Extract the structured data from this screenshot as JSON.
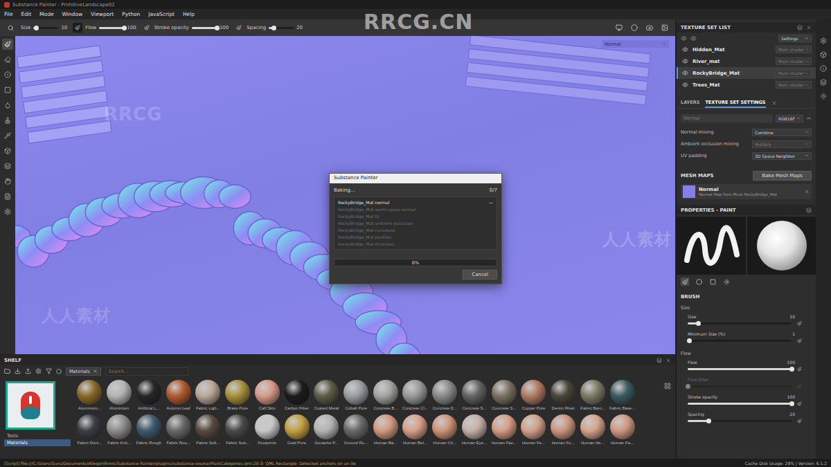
{
  "window": {
    "title": "Substance Painter - PrimitiveLandscape02"
  },
  "menu": [
    "File",
    "Edit",
    "Mode",
    "Window",
    "Viewport",
    "Python",
    "JavaScript",
    "Help"
  ],
  "watermarks": [
    {
      "text": "RRCG.CN"
    },
    {
      "text": "RRCG"
    },
    {
      "text": "人人素材"
    },
    {
      "text": "人人素材"
    }
  ],
  "toolbar": {
    "params": [
      {
        "label": "Size",
        "value": "10",
        "level": 0.1
      },
      {
        "label": "Flow",
        "value": "100",
        "level": 1
      },
      {
        "label": "Stroke opacity",
        "value": "100",
        "level": 1
      },
      {
        "label": "Spacing",
        "value": "20",
        "level": 0.2
      }
    ]
  },
  "tools": [
    {
      "kind": "paint",
      "selected": true
    },
    {
      "kind": "eraser",
      "selected": false
    },
    {
      "kind": "projection",
      "selected": false
    },
    {
      "kind": "polyfill",
      "selected": false
    },
    {
      "kind": "smudge",
      "selected": false
    },
    {
      "kind": "clone",
      "selected": false
    },
    {
      "kind": "picker",
      "selected": false
    },
    {
      "kind": "geometry",
      "selected": false
    },
    {
      "kind": "layers",
      "selected": false
    },
    {
      "kind": "hand",
      "selected": false
    },
    {
      "kind": "script",
      "selected": false
    },
    {
      "kind": "settings",
      "selected": false
    }
  ],
  "viewport": {
    "channel": "Normal"
  },
  "dialog": {
    "title": "Substance Painter",
    "status": "Baking...",
    "count": "0/7",
    "current": {
      "name": "RockyBridge_Mat normal",
      "mark": "—"
    },
    "log": [
      "RockyBridge_Mat world space normal",
      "RockyBridge_Mat ID",
      "RockyBridge_Mat ambient occlusion",
      "RockyBridge_Mat curvature",
      "RockyBridge_Mat position",
      "RockyBridge_Mat thickness"
    ],
    "progress": {
      "level": 0,
      "text": "0%"
    },
    "button": "Cancel"
  },
  "texture_set_list": {
    "title": "TEXTURE SET LIST",
    "settings": "Settings",
    "items": [
      {
        "name": "Hidden_Mat",
        "shader": "Main shader",
        "visible": true,
        "selected": false
      },
      {
        "name": "River_mat",
        "shader": "Main shader",
        "visible": true,
        "selected": false
      },
      {
        "name": "RockyBridge_Mat",
        "shader": "Main shader",
        "visible": true,
        "selected": true
      },
      {
        "name": "Trees_Mat",
        "shader": "Main shader",
        "visible": true,
        "selected": false
      }
    ]
  },
  "tabs": [
    {
      "label": "LAYERS",
      "selected": false
    },
    {
      "label": "TEXTURE SET SETTINGS",
      "selected": true
    }
  ],
  "texture_set_settings": {
    "channel": "Normal",
    "format": "RGB16F",
    "fields": [
      {
        "label": "Normal mixing",
        "value": "Combine",
        "disabled": false
      },
      {
        "label": "Ambient occlusion mixing",
        "value": "Multiply",
        "disabled": true
      },
      {
        "label": "UV padding",
        "value": "3D Space Neighbor",
        "disabled": false
      }
    ],
    "mesh_maps": {
      "title": "MESH MAPS",
      "button": "Bake Mesh Maps",
      "items": [
        {
          "name": "Normal",
          "description": "Normal Map from Mesh RockyBridge_Mat"
        }
      ]
    }
  },
  "properties": {
    "title": "PROPERTIES - PAINT",
    "section": "BRUSH",
    "controls": [
      {
        "kind": "heading",
        "label": "Size"
      },
      {
        "kind": "slider",
        "label": "Size",
        "value": "10",
        "level": 0.1,
        "disabled": false
      },
      {
        "kind": "slider",
        "label": "Minimum Size (%)",
        "value": "1",
        "level": 0.01,
        "disabled": false
      },
      {
        "kind": "heading",
        "label": "Flow"
      },
      {
        "kind": "slider",
        "label": "Flow",
        "value": "100",
        "level": 1,
        "disabled": false
      },
      {
        "kind": "slider",
        "label": "Flow Jitter",
        "level": 0,
        "disabled": true
      },
      {
        "kind": "slider",
        "label": "Stroke opacity",
        "value": "100",
        "level": 1,
        "disabled": false
      },
      {
        "kind": "slider",
        "label": "Spacing",
        "value": "20",
        "level": 0.2,
        "disabled": false
      }
    ]
  },
  "shelf": {
    "title": "SHELF",
    "filter_tag": "Materials",
    "search": {
      "placeholder": "Search..."
    },
    "categories": [
      {
        "label": "Tools",
        "selected": false
      },
      {
        "label": "Materials",
        "selected": true
      }
    ],
    "materials": [
      {
        "label": "Aluminium...",
        "color": "#8a6a2a"
      },
      {
        "label": "Aluminium",
        "color": "#b4b4b4"
      },
      {
        "label": "Artificial L...",
        "color": "#262626"
      },
      {
        "label": "Autumn Leaf",
        "color": "#b05a30"
      },
      {
        "label": "Fabric Ligh...",
        "color": "#b8a898"
      },
      {
        "label": "Brass Pure",
        "color": "#a8903c"
      },
      {
        "label": "Calf Skin",
        "color": "#d89a88"
      },
      {
        "label": "Carbon Fiber",
        "color": "#1c1c1c"
      },
      {
        "label": "Coated Metal",
        "color": "#5e5c48"
      },
      {
        "label": "Cobalt Pure",
        "color": "#9a9ea4"
      },
      {
        "label": "Concrete B...",
        "color": "#a4a4a0"
      },
      {
        "label": "Concrete Cl...",
        "color": "#9a9a9a"
      },
      {
        "label": "Concrete D...",
        "color": "#8a8a8a"
      },
      {
        "label": "Concrete S...",
        "color": "#646464"
      },
      {
        "label": "Concrete S...",
        "color": "#7a7262"
      },
      {
        "label": "Copper Pure",
        "color": "#b07a62"
      },
      {
        "label": "Denim Rivet",
        "color": "#4a4638"
      },
      {
        "label": "Fabric Bam...",
        "color": "#7a7a66"
      },
      {
        "label": "Fabric Base...",
        "color": "#3a5c60"
      },
      {
        "label": "Fabric Deni...",
        "color": "#3a3e46"
      },
      {
        "label": "Fabric Knit...",
        "color": "#8c8c8c"
      },
      {
        "label": "Fabric Rough",
        "color": "#3e5a6c"
      },
      {
        "label": "Fabric Rou...",
        "color": "#686868"
      },
      {
        "label": "Fabric Soft...",
        "color": "#5a4a40"
      },
      {
        "label": "Fabric Suit...",
        "color": "#4a4a4a"
      },
      {
        "label": "Footprints",
        "color": "#c8c8c8"
      },
      {
        "label": "Gold Pure",
        "color": "#c4a040"
      },
      {
        "label": "Gouache P...",
        "color": "#b4b4b4"
      },
      {
        "label": "Ground Ro...",
        "color": "#6a6a6a"
      },
      {
        "label": "Human Ba...",
        "color": "#d49a80"
      },
      {
        "label": "Human Bel...",
        "color": "#d8a088"
      },
      {
        "label": "Human Ch...",
        "color": "#d09478"
      },
      {
        "label": "Human Eye...",
        "color": "#c8b0a8"
      },
      {
        "label": "Human Fac...",
        "color": "#d89c84"
      },
      {
        "label": "Human Fe...",
        "color": "#d4a08a"
      },
      {
        "label": "Human Fo...",
        "color": "#cc9680"
      },
      {
        "label": "Human He...",
        "color": "#d8a48c"
      },
      {
        "label": "Human Fa...",
        "color": "#d09a82"
      }
    ]
  },
  "status_bar": {
    "message": "[Script] file:///C:/Users/Guru/Documents/Allegorithmic/Substance Painter/plugins/substance-source/PlainCategories.qml:20:3: QML Rectangle: Detected anchors on an ite",
    "info": "Cache Disk Usage: 29% | Version: 6.1.2"
  }
}
